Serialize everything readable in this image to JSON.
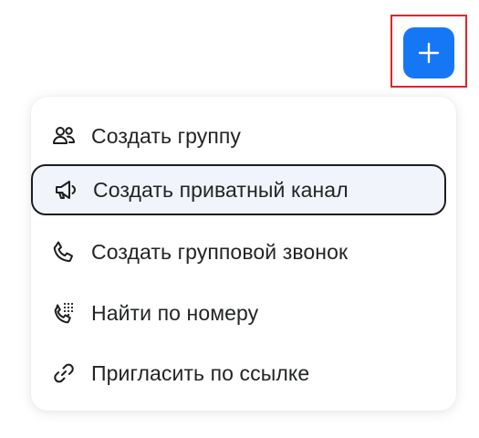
{
  "compose_button": {
    "icon": "plus-icon",
    "color": "#1677f5"
  },
  "highlight_color": "#e0242b",
  "menu": {
    "items": [
      {
        "label": "Создать группу",
        "icon": "group-icon"
      },
      {
        "label": "Создать приватный канал",
        "icon": "megaphone-icon",
        "active": true
      },
      {
        "label": "Создать групповой звонок",
        "icon": "phone-icon"
      },
      {
        "label": "Найти по номеру",
        "icon": "phone-dialpad-icon"
      },
      {
        "label": "Пригласить по ссылке",
        "icon": "link-icon"
      }
    ]
  }
}
